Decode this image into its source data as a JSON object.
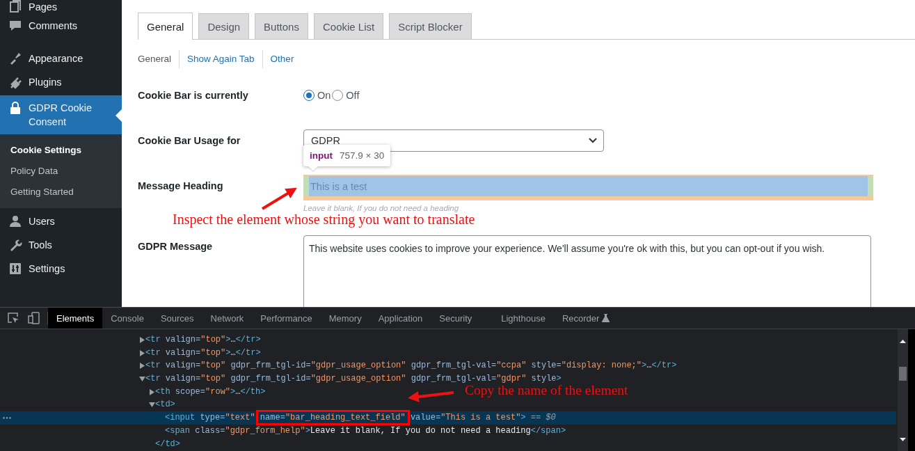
{
  "sidebar": {
    "items": [
      {
        "label": "Pages",
        "selected": false
      },
      {
        "label": "Comments",
        "selected": false
      },
      {
        "label": "Appearance",
        "selected": false
      },
      {
        "label": "Plugins",
        "selected": false
      },
      {
        "label": "GDPR Cookie Consent",
        "selected": true,
        "children": [
          {
            "label": "Cookie Settings",
            "selected": true
          },
          {
            "label": "Policy Data",
            "selected": false
          },
          {
            "label": "Getting Started",
            "selected": false
          }
        ]
      },
      {
        "label": "Users",
        "selected": false
      },
      {
        "label": "Tools",
        "selected": false
      },
      {
        "label": "Settings",
        "selected": false
      }
    ]
  },
  "settings": {
    "tabs": [
      {
        "label": "General",
        "selected": true
      },
      {
        "label": "Design",
        "selected": false
      },
      {
        "label": "Buttons",
        "selected": false
      },
      {
        "label": "Cookie List",
        "selected": false
      },
      {
        "label": "Script Blocker",
        "selected": false
      }
    ],
    "subnav": [
      {
        "label": "General",
        "selected": true
      },
      {
        "label": "Show Again Tab",
        "selected": false
      },
      {
        "label": "Other",
        "selected": false
      }
    ],
    "rows": [
      {
        "kind": "radio",
        "label": "Cookie Bar is currently",
        "options": [
          {
            "label": "On",
            "selected": true
          },
          {
            "label": "Off",
            "selected": false
          }
        ]
      },
      {
        "kind": "select",
        "label": "Cookie Bar Usage for",
        "value": "GDPR"
      },
      {
        "kind": "text",
        "label": "Message Heading",
        "value": "This is a test",
        "help": "Leave it blank, If you do not need a heading",
        "inspected": true
      },
      {
        "kind": "textarea",
        "label": "GDPR Message",
        "value": "This website uses cookies to improve your experience. We'll assume you're ok with this, but you can opt-out if you wish."
      }
    ],
    "inspect_tooltip": {
      "tag": "input",
      "size": "757.9 × 30"
    }
  },
  "devtools": {
    "tabs": [
      {
        "label": "Elements",
        "selected": true
      },
      {
        "label": "Console",
        "selected": false
      },
      {
        "label": "Sources",
        "selected": false
      },
      {
        "label": "Network",
        "selected": false
      },
      {
        "label": "Performance",
        "selected": false
      },
      {
        "label": "Memory",
        "selected": false
      },
      {
        "label": "Application",
        "selected": false
      },
      {
        "label": "Security",
        "selected": false
      },
      {
        "label": "Lighthouse",
        "selected": false
      },
      {
        "label": "Recorder",
        "selected": false
      }
    ],
    "dom_tree": [
      {
        "expanded": false,
        "selected": false,
        "tokens": [
          {
            "kind": "tag",
            "text": "<tr "
          },
          {
            "kind": "attr",
            "text": "valign="
          },
          {
            "kind": "value",
            "text": "\"top\""
          },
          {
            "kind": "tag",
            "text": ">"
          },
          {
            "kind": "text",
            "text": "…"
          },
          {
            "kind": "tag",
            "text": "</tr>"
          }
        ]
      },
      {
        "expanded": false,
        "selected": false,
        "tokens": [
          {
            "kind": "tag",
            "text": "<tr "
          },
          {
            "kind": "attr",
            "text": "valign="
          },
          {
            "kind": "value",
            "text": "\"top\""
          },
          {
            "kind": "tag",
            "text": ">"
          },
          {
            "kind": "text",
            "text": "…"
          },
          {
            "kind": "tag",
            "text": "</tr>"
          }
        ]
      },
      {
        "expanded": false,
        "selected": false,
        "tokens": [
          {
            "kind": "tag",
            "text": "<tr "
          },
          {
            "kind": "attr",
            "text": "valign="
          },
          {
            "kind": "value",
            "text": "\"top\""
          },
          {
            "kind": "attr",
            "text": " gdpr_frm_tgl-id="
          },
          {
            "kind": "value",
            "text": "\"gdpr_usage_option\""
          },
          {
            "kind": "attr",
            "text": " gdpr_frm_tgl-val="
          },
          {
            "kind": "value",
            "text": "\"ccpa\""
          },
          {
            "kind": "attr",
            "text": " style="
          },
          {
            "kind": "value",
            "text": "\"display: none;\""
          },
          {
            "kind": "tag",
            "text": ">"
          },
          {
            "kind": "text",
            "text": "…"
          },
          {
            "kind": "tag",
            "text": "</tr>"
          }
        ]
      },
      {
        "expanded": true,
        "selected": false,
        "tokens": [
          {
            "kind": "tag",
            "text": "<tr "
          },
          {
            "kind": "attr",
            "text": "valign="
          },
          {
            "kind": "value",
            "text": "\"top\""
          },
          {
            "kind": "attr",
            "text": " gdpr_frm_tgl-id="
          },
          {
            "kind": "value",
            "text": "\"gdpr_usage_option\""
          },
          {
            "kind": "attr",
            "text": " gdpr_frm_tgl-val="
          },
          {
            "kind": "value",
            "text": "\"gdpr\""
          },
          {
            "kind": "attr",
            "text": " style"
          },
          {
            "kind": "tag",
            "text": ">"
          }
        ],
        "children": [
          {
            "expanded": false,
            "selected": false,
            "tokens": [
              {
                "kind": "tag",
                "text": "<th "
              },
              {
                "kind": "attr",
                "text": "scope="
              },
              {
                "kind": "value",
                "text": "\"row\""
              },
              {
                "kind": "tag",
                "text": ">"
              },
              {
                "kind": "text",
                "text": "…"
              },
              {
                "kind": "tag",
                "text": "</th>"
              }
            ]
          },
          {
            "expanded": true,
            "selected": false,
            "tokens": [
              {
                "kind": "tag",
                "text": "<td>"
              }
            ],
            "closing": [
              {
                "kind": "tag",
                "text": "</td>"
              }
            ],
            "children": [
              {
                "selected": true,
                "tokens": [
                  {
                    "kind": "tag",
                    "text": "<input "
                  },
                  {
                    "kind": "attr",
                    "text": "type="
                  },
                  {
                    "kind": "value",
                    "text": "\"text\" "
                  },
                  {
                    "kind": "attr",
                    "text": "name=",
                    "boxed": true
                  },
                  {
                    "kind": "value",
                    "text": "\"bar_heading_text_field\"",
                    "boxed": true
                  },
                  {
                    "kind": "attr",
                    "text": " value="
                  },
                  {
                    "kind": "value",
                    "text": "\"This is a test\""
                  },
                  {
                    "kind": "tag",
                    "text": ">"
                  },
                  {
                    "kind": "ref",
                    "text": " == $0"
                  }
                ]
              },
              {
                "selected": false,
                "tokens": [
                  {
                    "kind": "tag",
                    "text": "<span "
                  },
                  {
                    "kind": "attr",
                    "text": "class="
                  },
                  {
                    "kind": "value",
                    "text": "\"gdpr_form_help\""
                  },
                  {
                    "kind": "tag",
                    "text": ">"
                  },
                  {
                    "kind": "text",
                    "text": "Leave it blank, If you do not need a heading"
                  },
                  {
                    "kind": "tag",
                    "text": "</span>"
                  }
                ]
              }
            ]
          }
        ]
      }
    ]
  },
  "annotations": [
    {
      "text": "Inspect the element whose string you want to translate"
    },
    {
      "text": "Copy the name of the element"
    }
  ]
}
